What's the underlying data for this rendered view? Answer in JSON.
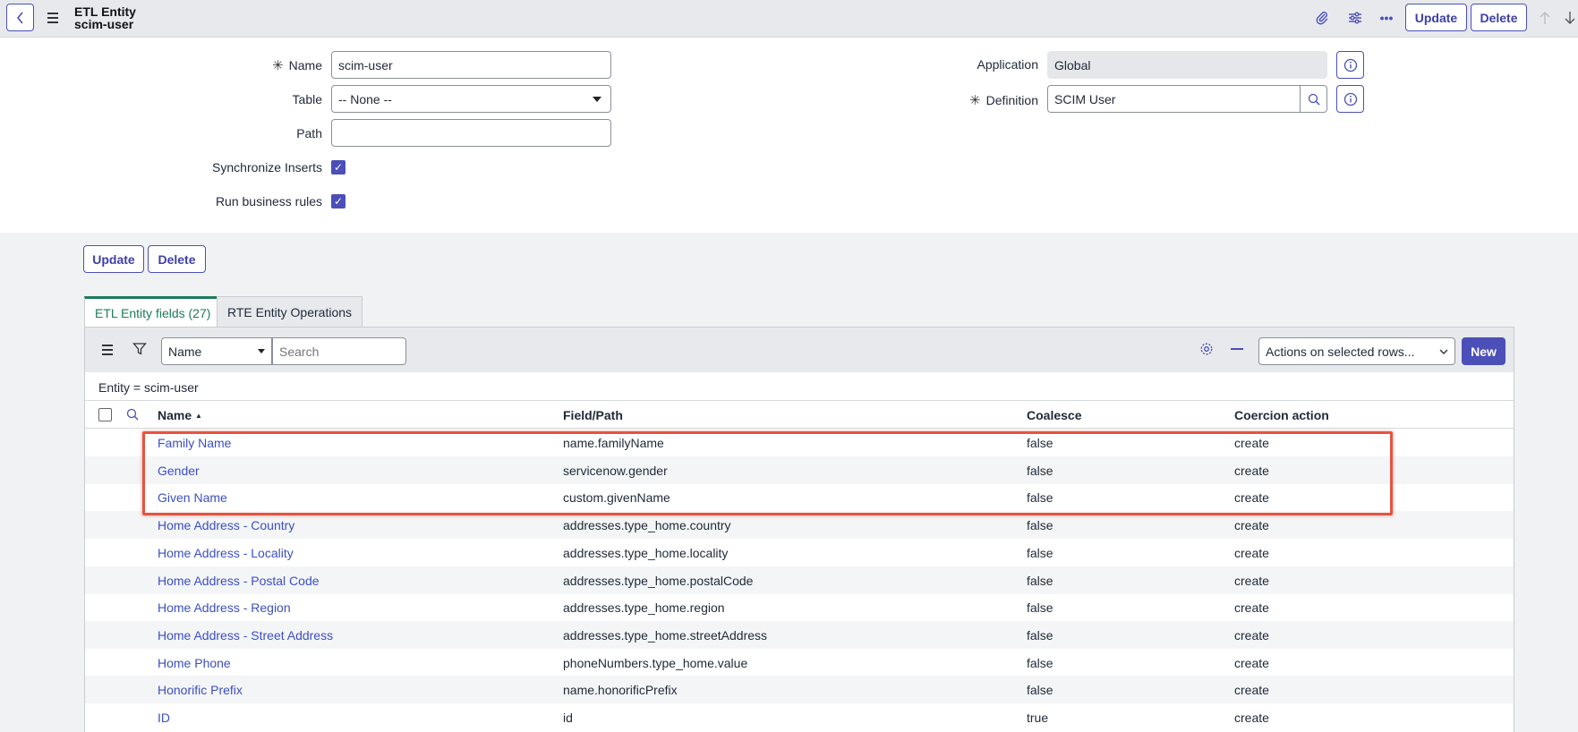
{
  "header": {
    "title": "ETL Entity",
    "subtitle": "scim-user",
    "update_label": "Update",
    "delete_label": "Delete"
  },
  "form": {
    "name_label": "Name",
    "name_value": "scim-user",
    "table_label": "Table",
    "table_value": "-- None --",
    "path_label": "Path",
    "path_value": "",
    "sync_inserts_label": "Synchronize Inserts",
    "run_business_rules_label": "Run business rules",
    "application_label": "Application",
    "application_value": "Global",
    "definition_label": "Definition",
    "definition_value": "SCIM User"
  },
  "actions": {
    "update_label": "Update",
    "delete_label": "Delete"
  },
  "tabs": [
    {
      "label": "ETL Entity fields (27)"
    },
    {
      "label": "RTE Entity Operations"
    }
  ],
  "list": {
    "search_field": "Name",
    "search_placeholder": "Search",
    "actions_select": "Actions on selected rows...",
    "new_label": "New",
    "filter": "Entity = scim-user",
    "columns": [
      "Name",
      "Field/Path",
      "Coalesce",
      "Coercion action"
    ],
    "rows": [
      {
        "name": "Family Name",
        "path": "name.familyName",
        "coalesce": "false",
        "coercion": "create"
      },
      {
        "name": "Gender",
        "path": "servicenow.gender",
        "coalesce": "false",
        "coercion": "create"
      },
      {
        "name": "Given Name",
        "path": "custom.givenName",
        "coalesce": "false",
        "coercion": "create"
      },
      {
        "name": "Home Address - Country",
        "path": "addresses.type_home.country",
        "coalesce": "false",
        "coercion": "create"
      },
      {
        "name": "Home Address - Locality",
        "path": "addresses.type_home.locality",
        "coalesce": "false",
        "coercion": "create"
      },
      {
        "name": "Home Address - Postal Code",
        "path": "addresses.type_home.postalCode",
        "coalesce": "false",
        "coercion": "create"
      },
      {
        "name": "Home Address - Region",
        "path": "addresses.type_home.region",
        "coalesce": "false",
        "coercion": "create"
      },
      {
        "name": "Home Address - Street Address",
        "path": "addresses.type_home.streetAddress",
        "coalesce": "false",
        "coercion": "create"
      },
      {
        "name": "Home Phone",
        "path": "phoneNumbers.type_home.value",
        "coalesce": "false",
        "coercion": "create"
      },
      {
        "name": "Honorific Prefix",
        "path": "name.honorificPrefix",
        "coalesce": "false",
        "coercion": "create"
      },
      {
        "name": "ID",
        "path": "id",
        "coalesce": "true",
        "coercion": "create"
      }
    ]
  },
  "icons": {
    "back": "chevron-left-icon",
    "menu": "hamburger-icon",
    "attach": "paperclip-icon",
    "settings": "sliders-icon",
    "more": "ellipsis-icon",
    "up": "arrow-up-icon",
    "down": "arrow-down-icon",
    "lookup": "search-icon",
    "info": "info-icon",
    "filter": "funnel-icon",
    "gear": "gear-icon",
    "collapse": "minus-icon"
  },
  "colors": {
    "accent": "#4b4fb7",
    "active_tab": "#1e7a5c",
    "link": "#3b4fc4",
    "highlight": "#e8533f"
  }
}
